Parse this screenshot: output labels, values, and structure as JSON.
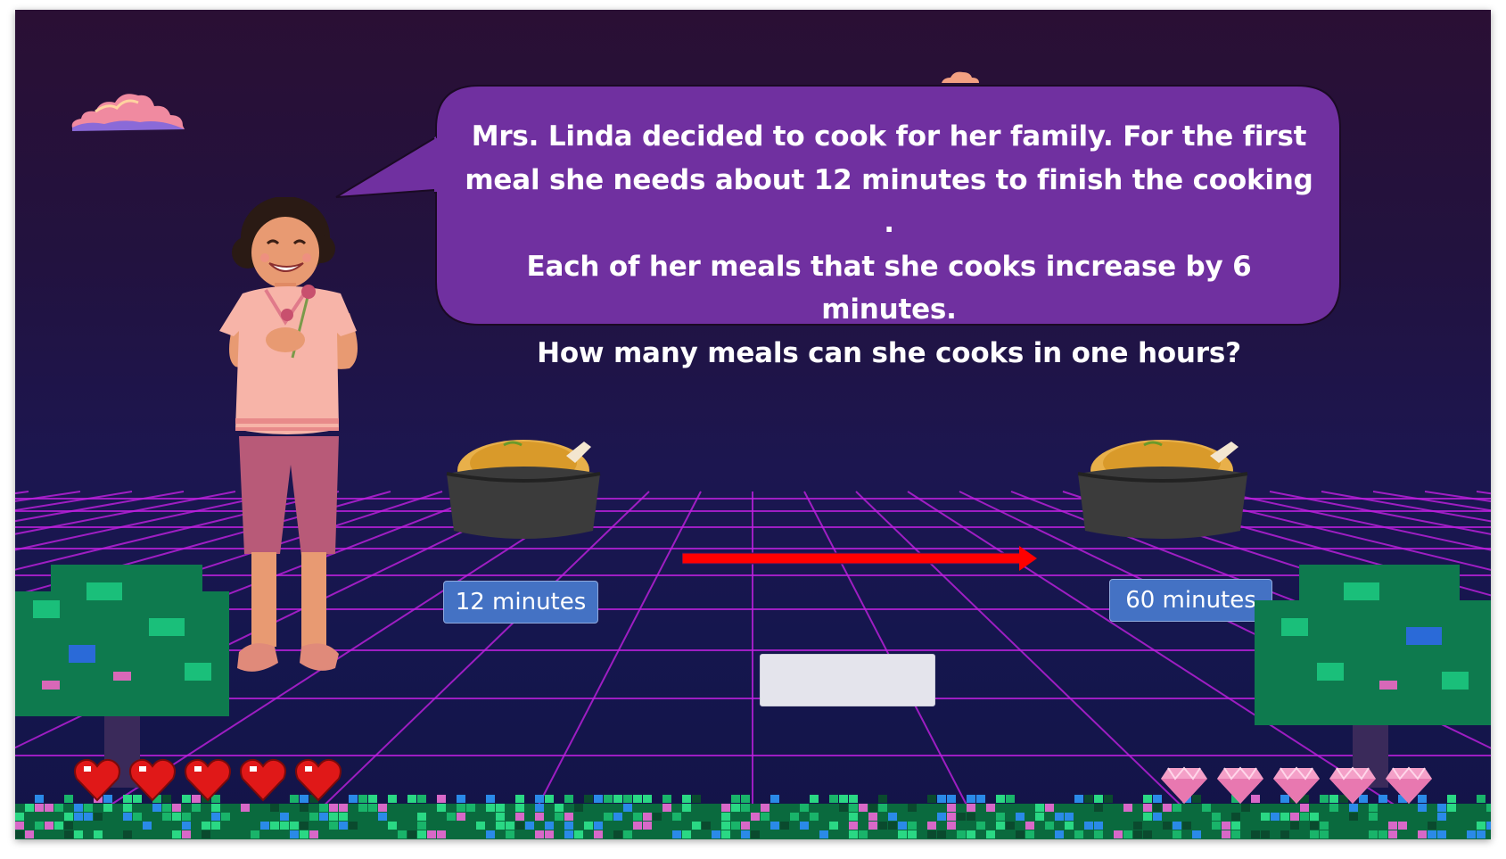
{
  "question": {
    "lines": [
      "Mrs. Linda decided to cook for her family. For the first",
      "meal she needs about 12 minutes to finish the cooking .",
      "Each of her meals that she cooks increase by 6 minutes.",
      "How many meals can she cooks in one hours?"
    ]
  },
  "labels": {
    "start_time": "12 minutes",
    "end_time": "60 minutes"
  },
  "answer": {
    "value": ""
  },
  "status": {
    "hearts": 5,
    "gems": 5
  },
  "colors": {
    "bubble": "#7030a0",
    "label": "#4472c4",
    "arrow": "#ff0000",
    "grid": "#c020e0"
  },
  "icons": {
    "life": "heart-icon",
    "reward": "gem-icon",
    "character": "woman-character",
    "food": "roast-chicken-pot"
  }
}
